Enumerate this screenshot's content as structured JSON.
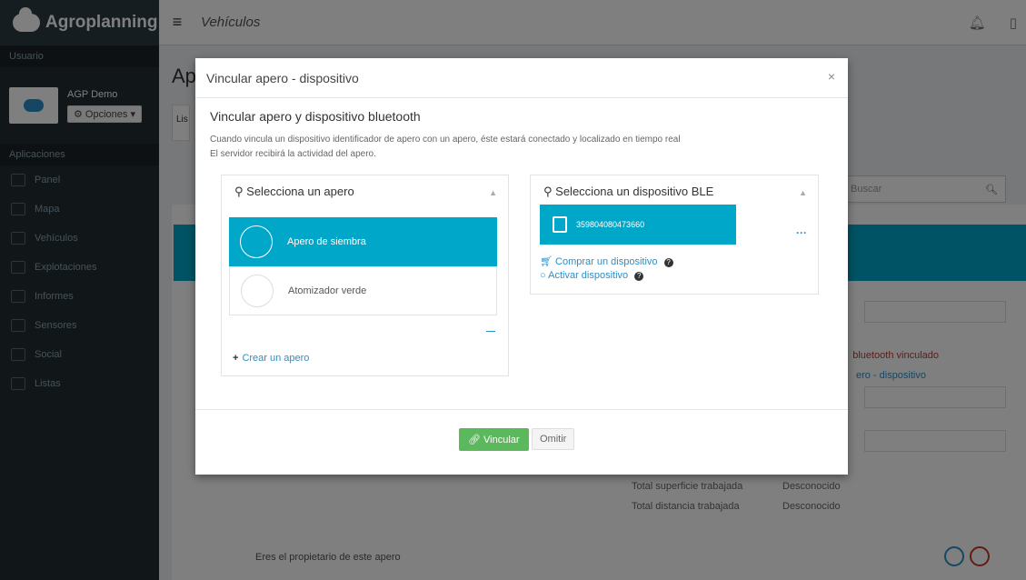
{
  "brand": {
    "name": "Agroplanning"
  },
  "sidebar": {
    "user_label": "Usuario",
    "user_name": "AGP Demo",
    "options_label": "⚙ Opciones ▾",
    "apps_label": "Aplicaciones",
    "items": [
      {
        "label": "Panel",
        "icon": "dashboard-icon"
      },
      {
        "label": "Mapa",
        "icon": "map-icon"
      },
      {
        "label": "Vehículos",
        "icon": "tractor-icon"
      },
      {
        "label": "Explotaciones",
        "icon": "farm-icon"
      },
      {
        "label": "Informes",
        "icon": "reports-icon"
      },
      {
        "label": "Sensores",
        "icon": "sensor-icon"
      },
      {
        "label": "Social",
        "icon": "social-icon"
      },
      {
        "label": "Listas",
        "icon": "list-icon"
      }
    ]
  },
  "header": {
    "title": "Vehículos"
  },
  "background": {
    "page_title_fragment": "Ap",
    "tab_fragment": "Lis",
    "search_placeholder": "Buscar",
    "red_text": "bluetooth vinculado",
    "blue_text": "ero - dispositivo",
    "rows": [
      {
        "label": "Total superficie trabajada",
        "value": "Desconocido"
      },
      {
        "label": "Total distancia trabajada",
        "value": "Desconocido"
      }
    ],
    "owner_text": "Eres el propietario de este apero"
  },
  "modal": {
    "title": "Vincular apero - dispositivo",
    "close": "×",
    "subtitle": "Vincular apero y dispositivo bluetooth",
    "desc_line1": "Cuando vincula un dispositivo identificador de apero con un apero, éste estará conectado y localizado en tiempo real",
    "desc_line2": "El servidor recibirá la actividad del apero.",
    "apero_panel": {
      "title": "Selecciona un apero",
      "items": [
        {
          "label": "Apero de siembra",
          "selected": true
        },
        {
          "label": "Atomizador verde",
          "selected": false
        }
      ],
      "create_label": "Crear un apero"
    },
    "ble_panel": {
      "title": "Selecciona un dispositivo BLE",
      "device_id": "359804080473660",
      "buy_label": "Comprar un dispositivo",
      "activate_label": "Activar dispositivo"
    },
    "vincular_label": "Vincular",
    "omitir_label": "Omitir"
  },
  "colors": {
    "teal": "#00a7c9",
    "sidebar": "#222d32",
    "green": "#5cb85c"
  }
}
